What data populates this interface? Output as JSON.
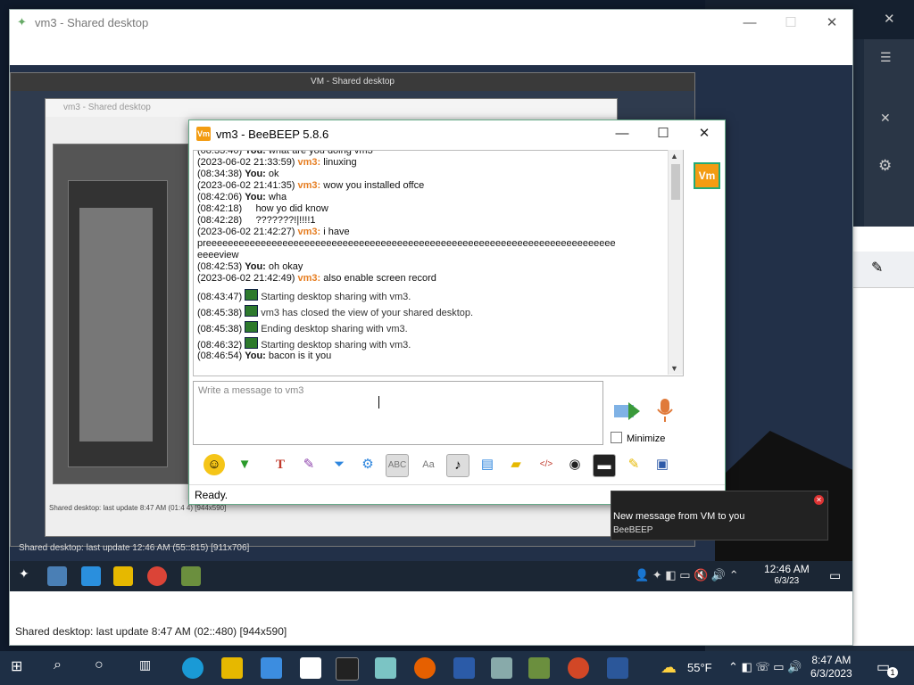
{
  "outer_window": {
    "title": "vm3 - Shared desktop",
    "status": "Shared desktop: last update 8:47 AM (02::480) [944x590]"
  },
  "remote": {
    "inner_title": "VM - Shared desktop",
    "inner_title2": "vm3 - Shared desktop",
    "inner_status": "Shared desktop: last update 12:46 AM (55::815) [911x706]",
    "inner_status2": "Shared desktop: last update 8:47 AM (01:4 4) [944x590]",
    "clock_time": "12:46 AM",
    "clock_date": "6/3/23"
  },
  "beebeep": {
    "title": "vm3 - BeeBEEP 5.8.6",
    "avatar": "Vm",
    "messages": [
      {
        "time": "(08:33:40)",
        "who": "You:",
        "who_type": "me",
        "text": " what are you doing vm3"
      },
      {
        "time": "(2023-06-02 21:33:59)",
        "who": "vm3:",
        "who_type": "vm3",
        "text": " linuxing"
      },
      {
        "time": "(08:34:38)",
        "who": "You:",
        "who_type": "me",
        "text": " ok"
      },
      {
        "time": "(2023-06-02 21:41:35)",
        "who": "vm3:",
        "who_type": "vm3",
        "text": " wow you installed offce"
      },
      {
        "time": "(08:42:06)",
        "who": "You:",
        "who_type": "me",
        "text": " wha"
      },
      {
        "time": "(08:42:18)",
        "who": "",
        "who_type": "none",
        "text": "    how yo did know"
      },
      {
        "time": "(08:42:28)",
        "who": "",
        "who_type": "none",
        "text": "    ???????!|!!!!1"
      },
      {
        "time": "(2023-06-02 21:42:27)",
        "who": "vm3:",
        "who_type": "vm3",
        "text": " i have"
      },
      {
        "time": "",
        "who": "",
        "who_type": "none",
        "text": "preeeeeeeeeeeeeeeeeeeeeeeeeeeeeeeeeeeeeeeeeeeeeeeeeeeeeeeeeeeeeeeeeeeeeeeeeee"
      },
      {
        "time": "",
        "who": "",
        "who_type": "none",
        "text": "eeeeview"
      },
      {
        "time": "(08:42:53)",
        "who": "You:",
        "who_type": "me",
        "text": " oh okay"
      },
      {
        "time": "(2023-06-02 21:42:49)",
        "who": "vm3:",
        "who_type": "vm3",
        "text": " also enable screen record"
      },
      {
        "time": "(08:43:47)",
        "who": "",
        "who_type": "sys",
        "text": "Starting desktop sharing with vm3."
      },
      {
        "time": "(08:45:38)",
        "who": "",
        "who_type": "sys",
        "text": "vm3 has closed the view of your shared desktop."
      },
      {
        "time": "(08:45:38)",
        "who": "",
        "who_type": "sys",
        "text": "Ending desktop sharing with vm3."
      },
      {
        "time": "(08:46:32)",
        "who": "",
        "who_type": "sys",
        "text": "Starting desktop sharing with vm3."
      },
      {
        "time": "(08:46:54)",
        "who": "You:",
        "who_type": "me",
        "text": " bacon is it you"
      }
    ],
    "input_placeholder": "Write a message to vm3",
    "minimize_label": "Minimize",
    "status": "Ready.",
    "toolbar_icons": [
      "emoji-icon",
      "bee-green-icon",
      "font-icon",
      "color-icon",
      "filter-icon",
      "settings-icon",
      "spellcheck-icon",
      "font-size-icon",
      "music-icon",
      "send-file-icon",
      "share-folder-icon",
      "code-icon",
      "record-icon",
      "screenshot-icon",
      "notes-icon",
      "save-icon"
    ]
  },
  "notification": {
    "line1": "New message from VM to you",
    "line2": "BeeBEEP"
  },
  "taskbar": {
    "temperature": "55°F",
    "time": "8:47 AM",
    "date": "6/3/2023",
    "badge": "1"
  }
}
